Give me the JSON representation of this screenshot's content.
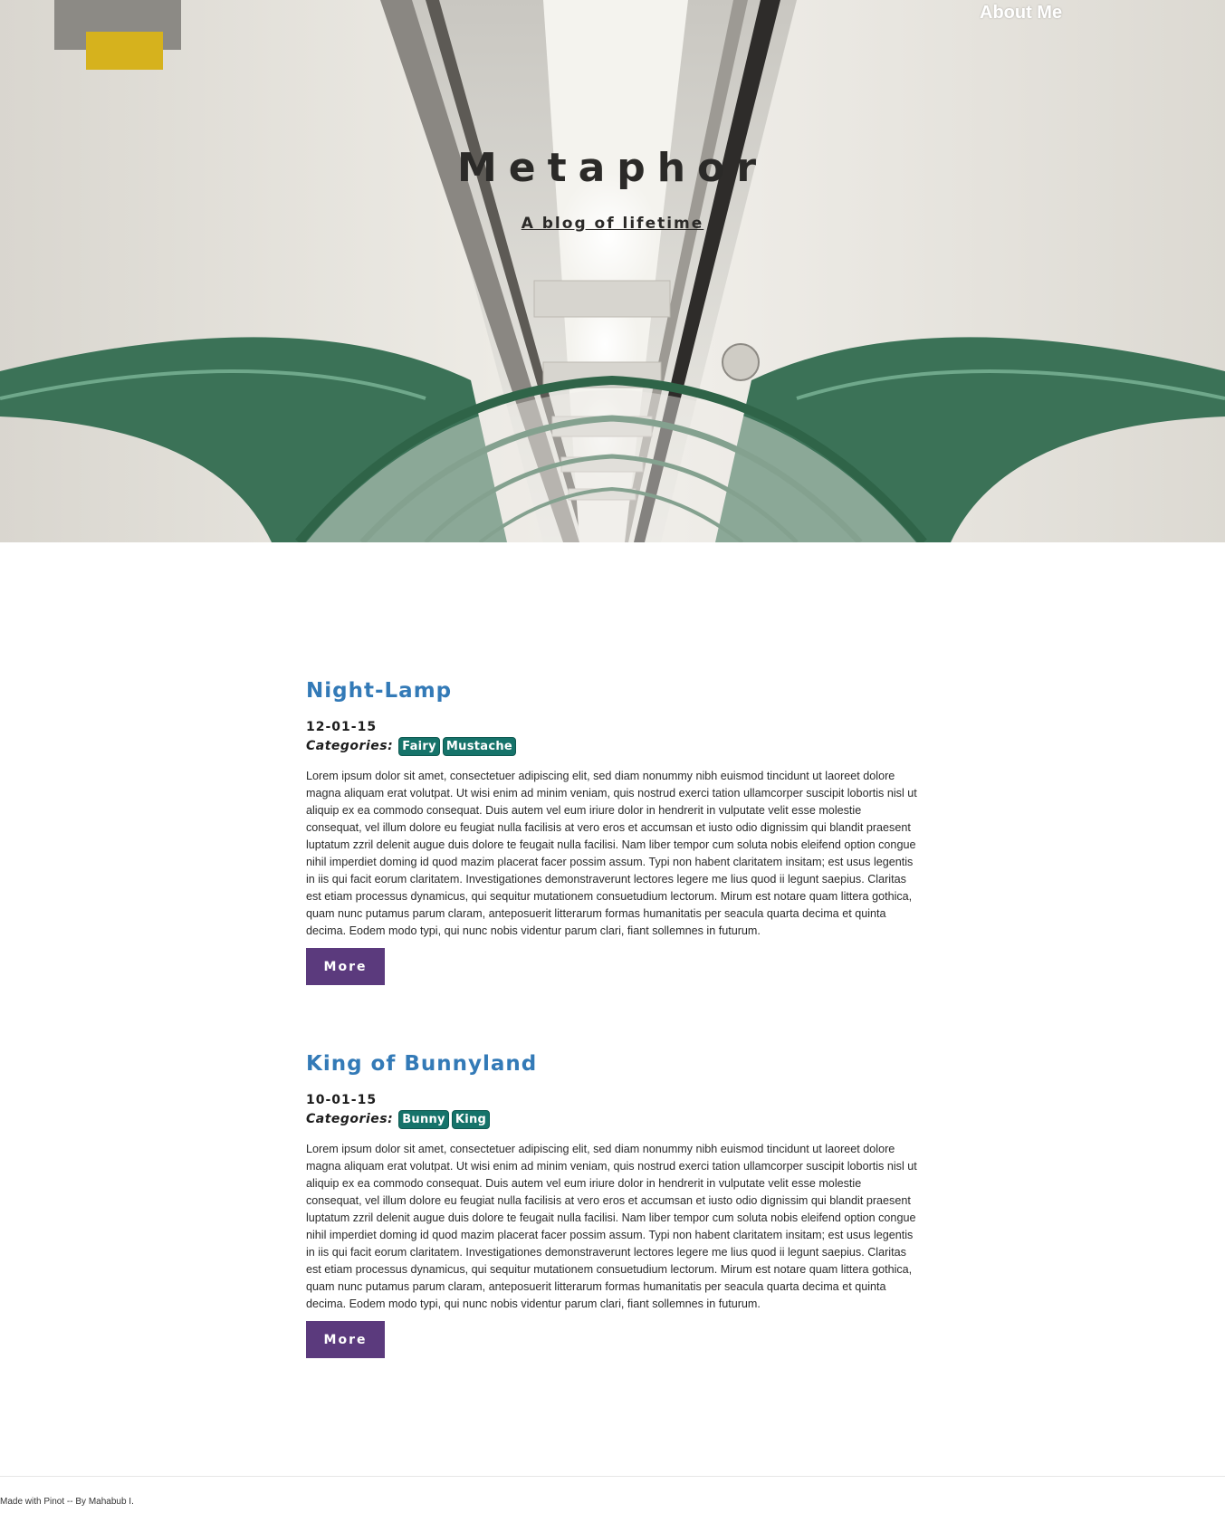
{
  "nav": {
    "about_label": "About Me"
  },
  "header": {
    "title": "Metaphor",
    "tagline": "A blog of lifetime"
  },
  "posts": [
    {
      "title": "Night-Lamp",
      "date": "12-01-15",
      "categories_label": "Categories:",
      "tags": [
        "Fairy",
        "Mustache"
      ],
      "body": "Lorem ipsum dolor sit amet, consectetuer adipiscing elit, sed diam nonummy nibh euismod tincidunt ut laoreet dolore magna aliquam erat volutpat. Ut wisi enim ad minim veniam, quis nostrud exerci tation ullamcorper suscipit lobortis nisl ut aliquip ex ea commodo consequat. Duis autem vel eum iriure dolor in hendrerit in vulputate velit esse molestie consequat, vel illum dolore eu feugiat nulla facilisis at vero eros et accumsan et iusto odio dignissim qui blandit praesent luptatum zzril delenit augue duis dolore te feugait nulla facilisi. Nam liber tempor cum soluta nobis eleifend option congue nihil imperdiet doming id quod mazim placerat facer possim assum. Typi non habent claritatem insitam; est usus legentis in iis qui facit eorum claritatem. Investigationes demonstraverunt lectores legere me lius quod ii legunt saepius. Claritas est etiam processus dynamicus, qui sequitur mutationem consuetudium lectorum. Mirum est notare quam littera gothica, quam nunc putamus parum claram, anteposuerit litterarum formas humanitatis per seacula quarta decima et quinta decima. Eodem modo typi, qui nunc nobis videntur parum clari, fiant sollemnes in futurum.",
      "more_label": "More"
    },
    {
      "title": "King of Bunnyland",
      "date": "10-01-15",
      "categories_label": "Categories:",
      "tags": [
        "Bunny",
        "King"
      ],
      "body": "Lorem ipsum dolor sit amet, consectetuer adipiscing elit, sed diam nonummy nibh euismod tincidunt ut laoreet dolore magna aliquam erat volutpat. Ut wisi enim ad minim veniam, quis nostrud exerci tation ullamcorper suscipit lobortis nisl ut aliquip ex ea commodo consequat. Duis autem vel eum iriure dolor in hendrerit in vulputate velit esse molestie consequat, vel illum dolore eu feugiat nulla facilisis at vero eros et accumsan et iusto odio dignissim qui blandit praesent luptatum zzril delenit augue duis dolore te feugait nulla facilisi. Nam liber tempor cum soluta nobis eleifend option congue nihil imperdiet doming id quod mazim placerat facer possim assum. Typi non habent claritatem insitam; est usus legentis in iis qui facit eorum claritatem. Investigationes demonstraverunt lectores legere me lius quod ii legunt saepius. Claritas est etiam processus dynamicus, qui sequitur mutationem consuetudium lectorum. Mirum est notare quam littera gothica, quam nunc putamus parum claram, anteposuerit litterarum formas humanitatis per seacula quarta decima et quinta decima. Eodem modo typi, qui nunc nobis videntur parum clari, fiant sollemnes in futurum.",
      "more_label": "More"
    }
  ],
  "footer": {
    "text": "Made with Pinot -- By Mahabub I."
  },
  "colors": {
    "title_link": "#337ab7",
    "tag_bg": "#16736a",
    "button_bg": "#5b3a7d"
  }
}
